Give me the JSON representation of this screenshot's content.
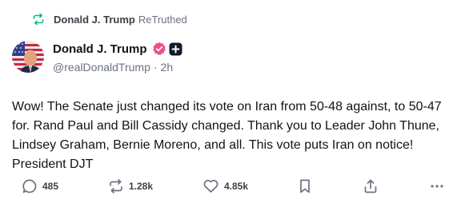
{
  "retruth": {
    "name": "Donald J. Trump",
    "suffix": "ReTruthed",
    "icon": "retruth-icon",
    "color": "#10b981"
  },
  "post": {
    "author": {
      "display_name": "Donald J. Trump",
      "handle": "@realDonaldTrump",
      "time": "2h",
      "badges": [
        "verified-icon",
        "plus-icon"
      ],
      "verified_color": "#ef4f86"
    },
    "text": "Wow! The Senate just changed its vote on Iran from 50-48 against, to 50-47 for. Rand Paul and Bill Cassidy changed. Thank you to Leader John Thune, Lindsey Graham, Bernie Moreno, and all. This vote puts Iran on notice! President DJT"
  },
  "actions": {
    "replies": "485",
    "retruths": "1.28k",
    "likes": "4.85k",
    "items": [
      "reply-icon",
      "retruth-icon",
      "like-icon",
      "bookmark-icon",
      "share-icon",
      "more-icon"
    ]
  }
}
